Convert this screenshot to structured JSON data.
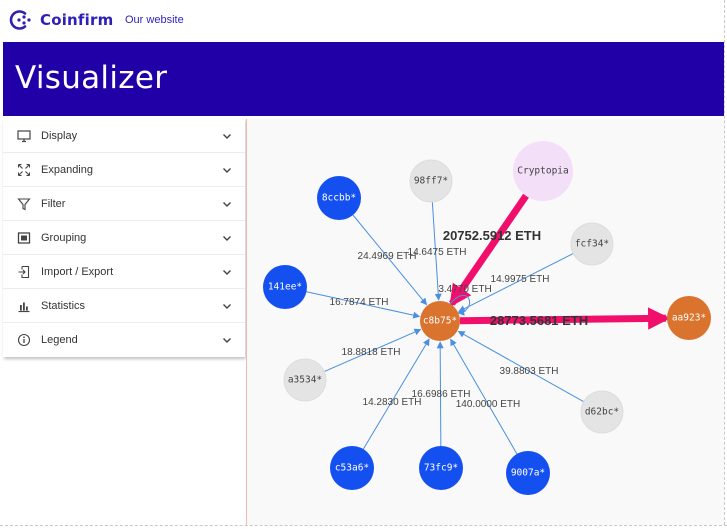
{
  "header": {
    "brand_name": "Coinfirm",
    "nav_link": "Our website"
  },
  "banner": {
    "title": "Visualizer"
  },
  "sidebar": {
    "items": [
      {
        "label": "Display",
        "icon": "monitor-icon"
      },
      {
        "label": "Expanding",
        "icon": "expand-arrows-icon"
      },
      {
        "label": "Filter",
        "icon": "filter-icon"
      },
      {
        "label": "Grouping",
        "icon": "grouping-icon"
      },
      {
        "label": "Import / Export",
        "icon": "import-export-icon"
      },
      {
        "label": "Statistics",
        "icon": "statistics-chart-icon"
      },
      {
        "label": "Legend",
        "icon": "info-icon"
      }
    ]
  },
  "graph": {
    "colors": {
      "center": "#d9732e",
      "blue": "#1450f0",
      "gray": "#e4e4e4",
      "exchange": "#f3dff8",
      "highlight_edge": "#f0106c",
      "edge": "#4a8fe0"
    },
    "nodes": [
      {
        "id": "c8b75",
        "label": "c8b75*",
        "kind": "center"
      },
      {
        "id": "cryptopia",
        "label": "Cryptopia",
        "kind": "exchange"
      },
      {
        "id": "aa923",
        "label": "aa923*",
        "kind": "center"
      },
      {
        "id": "98ff7",
        "label": "98ff7*",
        "kind": "gray"
      },
      {
        "id": "fcf34",
        "label": "fcf34*",
        "kind": "gray"
      },
      {
        "id": "a3534",
        "label": "a3534*",
        "kind": "gray"
      },
      {
        "id": "d62bc",
        "label": "d62bc*",
        "kind": "gray"
      },
      {
        "id": "8ccbb",
        "label": "8ccbb*",
        "kind": "blue"
      },
      {
        "id": "141ee",
        "label": "141ee*",
        "kind": "blue"
      },
      {
        "id": "c53a6",
        "label": "c53a6*",
        "kind": "blue"
      },
      {
        "id": "73fc9",
        "label": "73fc9*",
        "kind": "blue"
      },
      {
        "id": "9007a",
        "label": "9007a*",
        "kind": "blue"
      }
    ],
    "edges": [
      {
        "from": "cryptopia",
        "to": "c8b75",
        "label": "20752.5912 ETH",
        "highlight": true
      },
      {
        "from": "c8b75",
        "to": "aa923",
        "label": "28773.5681 ETH",
        "highlight": true
      },
      {
        "from": "8ccbb",
        "to": "c8b75",
        "label": "24.4969 ETH"
      },
      {
        "from": "98ff7",
        "to": "c8b75",
        "label": "14.6475 ETH"
      },
      {
        "from": "fcf34",
        "to": "c8b75",
        "label": "14.9975 ETH"
      },
      {
        "from": "c8b75",
        "to": "c8b75",
        "label": "3.4770 ETH"
      },
      {
        "from": "141ee",
        "to": "c8b75",
        "label": "16.7874 ETH"
      },
      {
        "from": "a3534",
        "to": "c8b75",
        "label": "18.8818 ETH"
      },
      {
        "from": "d62bc",
        "to": "c8b75",
        "label": "39.8803 ETH"
      },
      {
        "from": "c53a6",
        "to": "c8b75",
        "label": "14.2830 ETH"
      },
      {
        "from": "73fc9",
        "to": "c8b75",
        "label": "16.6986 ETH"
      },
      {
        "from": "9007a",
        "to": "c8b75",
        "label": "140.0000 ETH"
      }
    ]
  }
}
